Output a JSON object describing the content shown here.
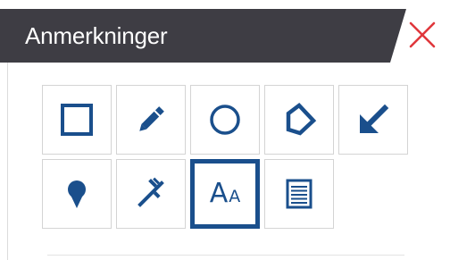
{
  "panel": {
    "title": "Anmerkninger",
    "close_icon": "close-icon"
  },
  "colors": {
    "header_bg": "#3e3d44",
    "icon_blue": "#1a4f8c",
    "close_red": "#e0373c",
    "selected_border": "#1a4f8c"
  },
  "tools": [
    {
      "name": "rectangle-tool",
      "icon": "square-icon"
    },
    {
      "name": "pencil-tool",
      "icon": "pencil-icon"
    },
    {
      "name": "circle-tool",
      "icon": "circle-icon"
    },
    {
      "name": "polygon-tool",
      "icon": "polygon-icon"
    },
    {
      "name": "arrow-tool",
      "icon": "arrow-down-left-icon"
    },
    {
      "name": "pin-tool",
      "icon": "map-pin-icon"
    },
    {
      "name": "measure-tool",
      "icon": "caliper-icon"
    },
    {
      "name": "text-tool",
      "icon": "text-size-icon",
      "selected": true,
      "glyph_big": "A",
      "glyph_small": "A"
    },
    {
      "name": "note-tool",
      "icon": "note-icon"
    }
  ]
}
